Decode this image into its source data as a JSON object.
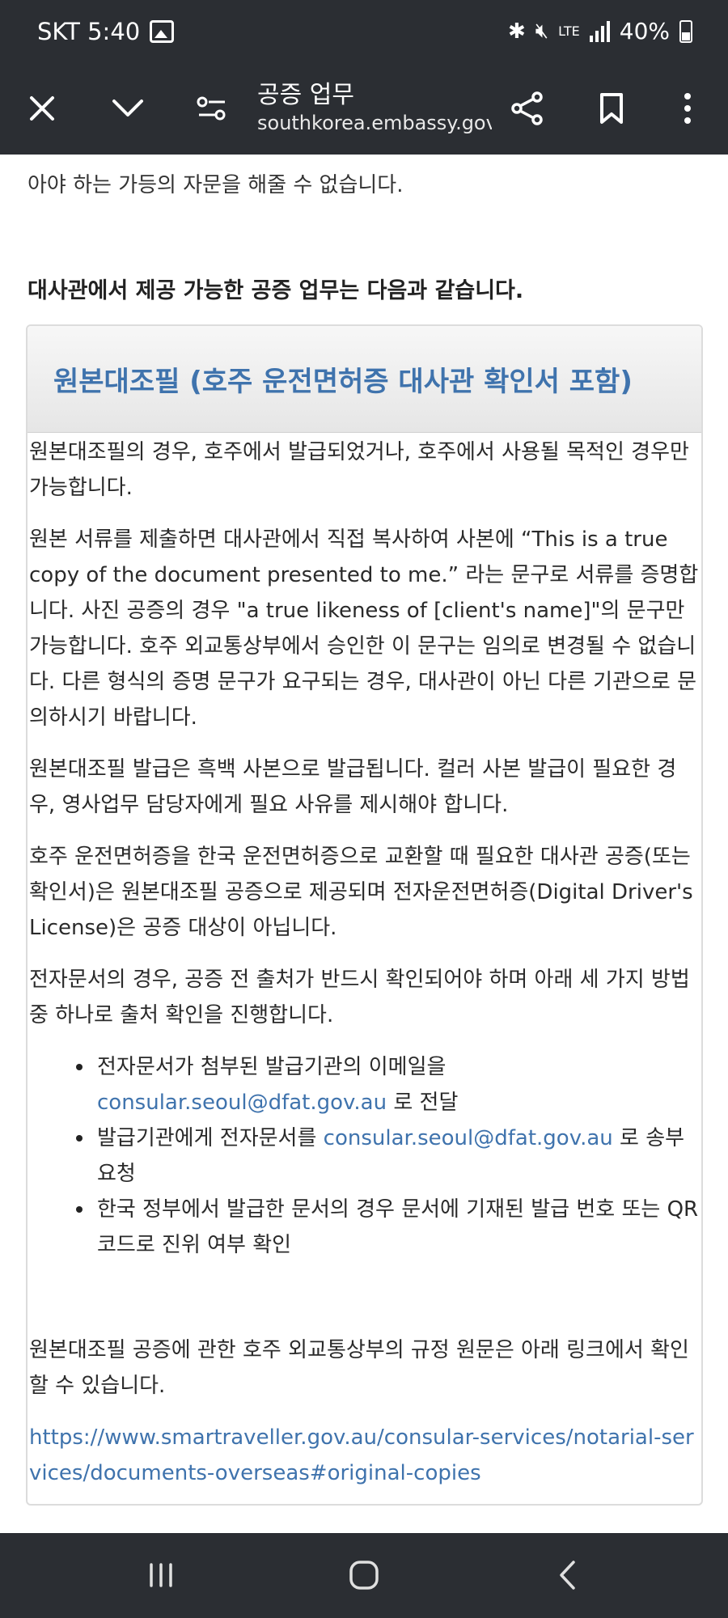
{
  "status_bar": {
    "carrier_time": "SKT 5:40",
    "network": "LTE",
    "battery": "40%"
  },
  "toolbar": {
    "title": "공증 업무",
    "url": "southkorea.embassy.gov.au"
  },
  "content": {
    "intro_tail": "아야 하는 가등의 자문을 해줄 수 없습니다.",
    "subheading": "대사관에서 제공 가능한 공증 업무는 다음과 같습니다.",
    "card": {
      "title": "원본대조필 (호주 운전면허증 대사관 확인서 포함)",
      "paragraphs": [
        "원본대조필의 경우, 호주에서 발급되었거나, 호주에서 사용될 목적인 경우만 가능합니다.",
        "원본 서류를 제출하면 대사관에서 직접 복사하여 사본에 “This is a true copy of the document presented to me.” 라는 문구로 서류를 증명합니다. 사진 공증의 경우 \"a true likeness of [client's name]\"의 문구만 가능합니다. 호주 외교통상부에서 승인한 이 문구는 임의로 변경될 수 없습니다. 다른 형식의 증명 문구가 요구되는 경우, 대사관이 아닌 다른 기관으로 문의하시기 바랍니다.",
        "원본대조필 발급은 흑백 사본으로 발급됩니다. 컬러 사본 발급이 필요한 경우, 영사업무 담당자에게 필요 사유를 제시해야 합니다.",
        "호주 운전면허증을 한국 운전면허증으로 교환할 때 필요한 대사관 공증(또는 확인서)은 원본대조필 공증으로 제공되며 전자운전면허증(Digital Driver's License)은 공증 대상이 아닙니다.",
        "전자문서의 경우, 공증 전 출처가 반드시 확인되어야 하며 아래 세 가지 방법 중 하나로 출처 확인을 진행합니다."
      ],
      "bullets": [
        {
          "before": "전자문서가 첨부된 발급기관의 이메일을 ",
          "link": "consular.seoul@dfat.gov.au",
          "after": " 로 전달"
        },
        {
          "before": "발급기관에게 전자문서를 ",
          "link": "consular.seoul@dfat.gov.au",
          "after": " 로 송부 요청"
        },
        {
          "before": "한국 정부에서 발급한 문서의 경우 문서에 기재된 발급 번호 또는 QR 코드로 진위 여부 확인",
          "link": "",
          "after": ""
        }
      ],
      "closing": "원본대조필 공증에 관한 호주 외교통상부의 규정 원문은 아래 링크에서 확인할 수 있습니다.",
      "reference_url": "https://www.smartraveller.gov.au/consular-services/notarial-services/documents-overseas#original-copies"
    }
  },
  "icons": {
    "close": "close-icon",
    "expand": "chevron-down-icon",
    "page_settings": "tune-icon",
    "share": "share-icon",
    "bookmark": "bookmark-icon",
    "more": "more-vert-icon"
  },
  "colors": {
    "bar_background": "#2b2e33",
    "link": "#3f73ad",
    "card_title": "#3f73ad"
  }
}
